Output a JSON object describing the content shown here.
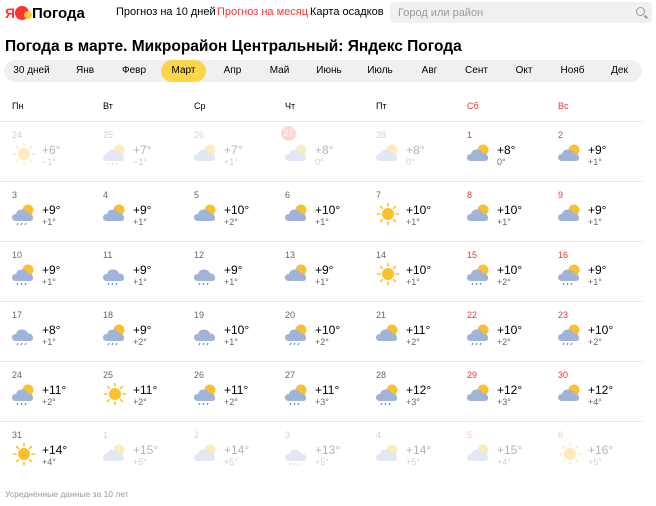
{
  "header": {
    "logo_text": "Погода",
    "nav": [
      "Прогноз на 10 дней",
      "Прогноз на месяц",
      "Карта осадков"
    ],
    "search_placeholder": "Город или район"
  },
  "title": "Погода в марте. Микрорайон Центральный: Яндекс Погода",
  "months": [
    "30 дней",
    "Янв",
    "Февр",
    "Март",
    "Апр",
    "Май",
    "Июнь",
    "Июль",
    "Авг",
    "Сент",
    "Окт",
    "Нояб",
    "Дек"
  ],
  "active_month": "Март",
  "weekdays": [
    "Пн",
    "Вт",
    "Ср",
    "Чт",
    "Пт",
    "Сб",
    "Вс"
  ],
  "days": [
    {
      "d": "24",
      "day": "+6°",
      "night": "−1°",
      "icon": "sun",
      "faded": true
    },
    {
      "d": "25",
      "day": "+7°",
      "night": "−1°",
      "icon": "cloud-sun-rain",
      "faded": true
    },
    {
      "d": "26",
      "day": "+7°",
      "night": "+1°",
      "icon": "cloud-sun",
      "faded": true
    },
    {
      "d": "27",
      "day": "+8°",
      "night": "0°",
      "icon": "cloud-sun",
      "faded": true,
      "today": true
    },
    {
      "d": "28",
      "day": "+8°",
      "night": "0°",
      "icon": "cloud-sun",
      "faded": true
    },
    {
      "d": "1",
      "day": "+8°",
      "night": "0°",
      "icon": "cloud-sun"
    },
    {
      "d": "2",
      "day": "+9°",
      "night": "+1°",
      "icon": "cloud-sun"
    },
    {
      "d": "3",
      "day": "+9°",
      "night": "+1°",
      "icon": "cloud-sun-rain"
    },
    {
      "d": "4",
      "day": "+9°",
      "night": "+1°",
      "icon": "cloud-sun"
    },
    {
      "d": "5",
      "day": "+10°",
      "night": "+2°",
      "icon": "cloud-sun"
    },
    {
      "d": "6",
      "day": "+10°",
      "night": "+1°",
      "icon": "cloud-sun"
    },
    {
      "d": "7",
      "day": "+10°",
      "night": "+1°",
      "icon": "sun"
    },
    {
      "d": "8",
      "day": "+10°",
      "night": "+1°",
      "icon": "cloud-sun"
    },
    {
      "d": "9",
      "day": "+9°",
      "night": "+1°",
      "icon": "cloud-sun"
    },
    {
      "d": "10",
      "day": "+9°",
      "night": "+1°",
      "icon": "cloud-sun-rain"
    },
    {
      "d": "11",
      "day": "+9°",
      "night": "+1°",
      "icon": "cloud-rain"
    },
    {
      "d": "12",
      "day": "+9°",
      "night": "+1°",
      "icon": "cloud-rain"
    },
    {
      "d": "13",
      "day": "+9°",
      "night": "+1°",
      "icon": "cloud-sun"
    },
    {
      "d": "14",
      "day": "+10°",
      "night": "+1°",
      "icon": "sun"
    },
    {
      "d": "15",
      "day": "+10°",
      "night": "+2°",
      "icon": "cloud-sun-rain"
    },
    {
      "d": "16",
      "day": "+9°",
      "night": "+1°",
      "icon": "cloud-sun-rain"
    },
    {
      "d": "17",
      "day": "+8°",
      "night": "+1°",
      "icon": "cloud-rain"
    },
    {
      "d": "18",
      "day": "+9°",
      "night": "+2°",
      "icon": "cloud-sun-rain"
    },
    {
      "d": "19",
      "day": "+10°",
      "night": "+1°",
      "icon": "cloud-rain"
    },
    {
      "d": "20",
      "day": "+10°",
      "night": "+2°",
      "icon": "cloud-sun-rain"
    },
    {
      "d": "21",
      "day": "+11°",
      "night": "+2°",
      "icon": "cloud-sun"
    },
    {
      "d": "22",
      "day": "+10°",
      "night": "+2°",
      "icon": "cloud-sun-rain"
    },
    {
      "d": "23",
      "day": "+10°",
      "night": "+2°",
      "icon": "cloud-sun-rain"
    },
    {
      "d": "24",
      "day": "+11°",
      "night": "+2°",
      "icon": "cloud-sun-rain"
    },
    {
      "d": "25",
      "day": "+11°",
      "night": "+2°",
      "icon": "sun"
    },
    {
      "d": "26",
      "day": "+11°",
      "night": "+2°",
      "icon": "cloud-sun-rain"
    },
    {
      "d": "27",
      "day": "+11°",
      "night": "+3°",
      "icon": "cloud-sun-rain"
    },
    {
      "d": "28",
      "day": "+12°",
      "night": "+3°",
      "icon": "cloud-sun-rain"
    },
    {
      "d": "29",
      "day": "+12°",
      "night": "+3°",
      "icon": "cloud-sun"
    },
    {
      "d": "30",
      "day": "+12°",
      "night": "+4°",
      "icon": "cloud-sun"
    },
    {
      "d": "31",
      "day": "+14°",
      "night": "+4°",
      "icon": "sun"
    },
    {
      "d": "1",
      "day": "+15°",
      "night": "+5°",
      "icon": "cloud-sun",
      "faded": true
    },
    {
      "d": "2",
      "day": "+14°",
      "night": "+5°",
      "icon": "cloud-sun",
      "faded": true
    },
    {
      "d": "3",
      "day": "+13°",
      "night": "+5°",
      "icon": "cloud-rain",
      "faded": true
    },
    {
      "d": "4",
      "day": "+14°",
      "night": "+5°",
      "icon": "cloud-sun",
      "faded": true
    },
    {
      "d": "5",
      "day": "+15°",
      "night": "+4°",
      "icon": "cloud-sun",
      "faded": true
    },
    {
      "d": "6",
      "day": "+16°",
      "night": "+5°",
      "icon": "sun",
      "faded": true
    }
  ],
  "footnote": "Усреднённые данные за 10 лет",
  "colors": {
    "accent": "#fcd54a",
    "weekend": "#e33",
    "brand": "#f33",
    "today": "#f47f73"
  }
}
